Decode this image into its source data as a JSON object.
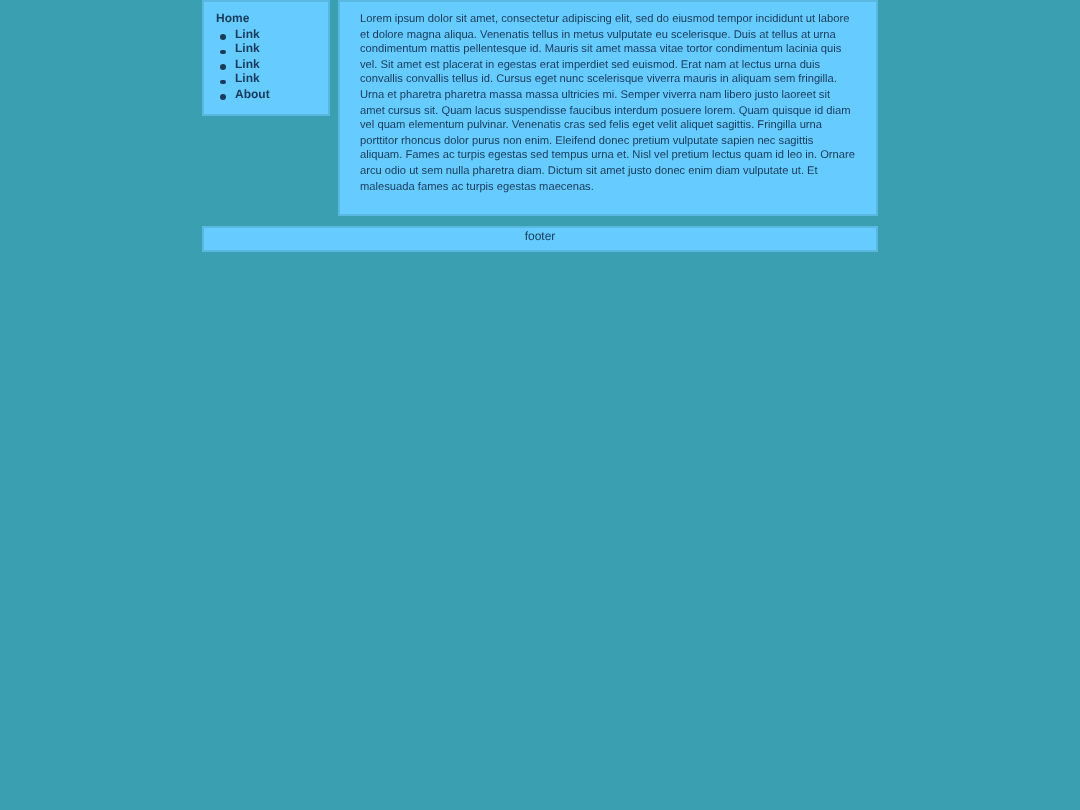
{
  "sidebar": {
    "title": "Home",
    "items": [
      {
        "label": "Link"
      },
      {
        "label": "Link"
      },
      {
        "label": "Link"
      },
      {
        "label": "Link"
      },
      {
        "label": "About"
      }
    ]
  },
  "content": {
    "text": "Lorem ipsum dolor sit amet, consectetur adipiscing elit, sed do eiusmod tempor incididunt ut labore et dolore magna aliqua. Venenatis tellus in metus vulputate eu scelerisque. Duis at tellus at urna condimentum mattis pellentesque id. Mauris sit amet massa vitae tortor condimentum lacinia quis vel. Sit amet est placerat in egestas erat imperdiet sed euismod. Erat nam at lectus urna duis convallis convallis tellus id. Cursus eget nunc scelerisque viverra mauris in aliquam sem fringilla. Urna et pharetra pharetra massa massa ultricies mi. Semper viverra nam libero justo laoreet sit amet cursus sit. Quam lacus suspendisse faucibus interdum posuere lorem. Quam quisque id diam vel quam elementum pulvinar. Venenatis cras sed felis eget velit aliquet sagittis. Fringilla urna porttitor rhoncus dolor purus non enim. Eleifend donec pretium vulputate sapien nec sagittis aliquam. Fames ac turpis egestas sed tempus urna et. Nisl vel pretium lectus quam id leo in. Ornare arcu odio ut sem nulla pharetra diam. Dictum sit amet justo donec enim diam vulputate ut. Et malesuada fames ac turpis egestas maecenas."
  },
  "footer": {
    "text": "footer"
  }
}
